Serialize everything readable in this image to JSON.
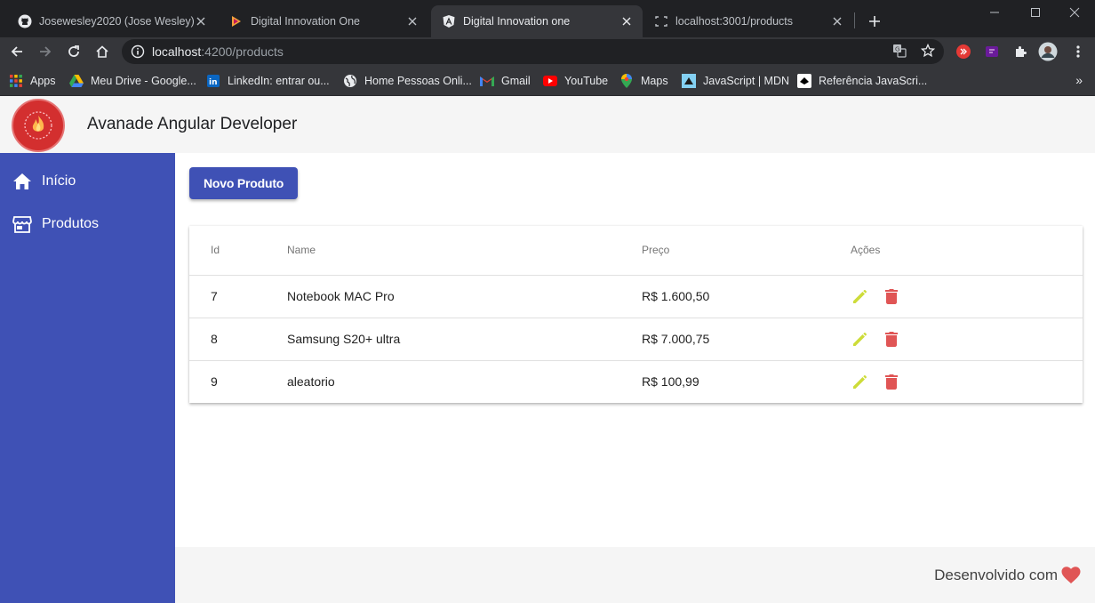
{
  "browser": {
    "tabs": [
      {
        "title": "Josewesley2020 (Jose Wesley)",
        "icon": "github-icon",
        "active": false
      },
      {
        "title": "Digital Innovation One",
        "icon": "dio-icon",
        "active": false
      },
      {
        "title": "Digital Innovation one",
        "icon": "angular-icon",
        "active": true
      },
      {
        "title": "localhost:3001/products",
        "icon": "page-icon",
        "active": false
      }
    ],
    "url_host": "localhost",
    "url_path": ":4200/products",
    "bookmarks": [
      {
        "label": "Apps",
        "icon": "apps-grid-icon"
      },
      {
        "label": "Meu Drive - Google...",
        "icon": "google-drive-icon"
      },
      {
        "label": "LinkedIn: entrar ou...",
        "icon": "linkedin-icon"
      },
      {
        "label": "Home Pessoas Onli...",
        "icon": "globe-icon"
      },
      {
        "label": "Gmail",
        "icon": "gmail-icon"
      },
      {
        "label": "YouTube",
        "icon": "youtube-icon"
      },
      {
        "label": "Maps",
        "icon": "maps-icon"
      },
      {
        "label": "JavaScript | MDN",
        "icon": "mdn-icon"
      },
      {
        "label": "Referência JavaScri...",
        "icon": "reference-icon"
      }
    ]
  },
  "app": {
    "title": "Avanade Angular Developer",
    "nav": [
      {
        "label": "Início",
        "icon": "home-icon"
      },
      {
        "label": "Produtos",
        "icon": "store-icon"
      }
    ],
    "new_button": "Novo Produto",
    "table": {
      "headers": [
        "Id",
        "Name",
        "Preço",
        "Ações"
      ],
      "rows": [
        {
          "id": "7",
          "name": "Notebook MAC Pro",
          "price": "R$ 1.600,50"
        },
        {
          "id": "8",
          "name": "Samsung S20+ ultra",
          "price": "R$ 7.000,75"
        },
        {
          "id": "9",
          "name": "aleatorio",
          "price": "R$ 100,99"
        }
      ]
    },
    "footer": "Desenvolvido com"
  },
  "colors": {
    "primary": "#3f51b5",
    "edit": "#cddc39",
    "delete": "#e05555",
    "heart": "#e05555"
  }
}
